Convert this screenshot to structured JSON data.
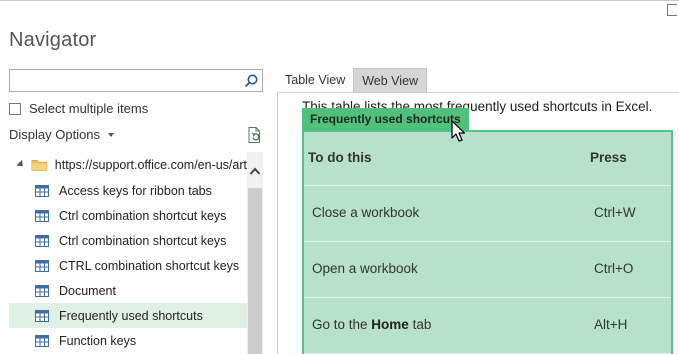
{
  "window": {
    "title": "Navigator",
    "restore_icon": "restore-window-icon"
  },
  "search": {
    "value": "",
    "placeholder": "",
    "icon": "search-icon"
  },
  "select_multiple": {
    "label": "Select multiple items",
    "checked": false
  },
  "display_options": {
    "label": "Display Options",
    "icon": "chevron-down-icon"
  },
  "refresh_icon": "refresh-document-icon",
  "tree": {
    "root": {
      "label": "https://support.office.com/en-us/art",
      "icon": "folder-icon",
      "expanded": true
    },
    "items": [
      {
        "label": "Access keys for ribbon tabs",
        "icon": "table-icon",
        "selected": false
      },
      {
        "label": "Ctrl combination shortcut keys",
        "icon": "table-icon",
        "selected": false
      },
      {
        "label": "Ctrl combination shortcut keys",
        "icon": "table-icon",
        "selected": false
      },
      {
        "label": "CTRL combination shortcut keys",
        "icon": "table-icon",
        "selected": false
      },
      {
        "label": "Document",
        "icon": "table-icon",
        "selected": false
      },
      {
        "label": "Frequently used shortcuts",
        "icon": "table-icon",
        "selected": true
      },
      {
        "label": "Function keys",
        "icon": "table-icon",
        "selected": false
      }
    ]
  },
  "tabs": [
    {
      "label": "Table View",
      "active": false
    },
    {
      "label": "Web View",
      "active": true
    }
  ],
  "preview": {
    "intro_text": "This table lists the most frequently used shortcuts in Excel.",
    "caption": "Frequently used shortcuts",
    "table": {
      "headers": [
        "To do this",
        "Press"
      ],
      "rows": [
        {
          "action_prefix": "Close a workbook",
          "action_bold": "",
          "action_suffix": "",
          "keys": "Ctrl+W"
        },
        {
          "action_prefix": "Open a workbook",
          "action_bold": "",
          "action_suffix": "",
          "keys": "Ctrl+O"
        },
        {
          "action_prefix": "Go to the ",
          "action_bold": "Home",
          "action_suffix": " tab",
          "keys": "Alt+H"
        }
      ]
    }
  },
  "colors": {
    "selection": "#def1e4",
    "caption_bg": "#52c07d",
    "table_bg": "#b7e1c9",
    "table_border": "#58c384",
    "active_tab_bg": "#d6d6d6"
  }
}
